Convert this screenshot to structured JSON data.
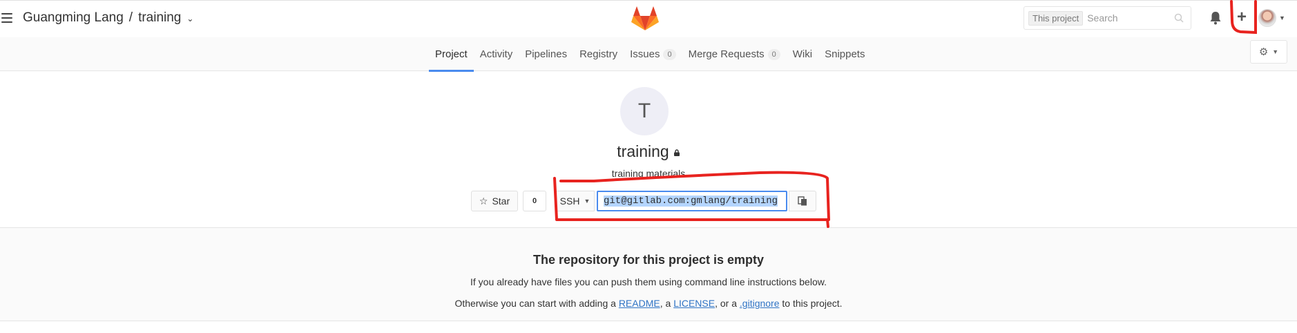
{
  "header": {
    "breadcrumb": {
      "owner": "Guangming Lang",
      "separator": "/",
      "project": "training"
    },
    "search": {
      "scope_label": "This project",
      "placeholder": "Search"
    },
    "icons": [
      "hamburger-icon",
      "gitlab-logo",
      "search-icon",
      "bell-icon",
      "plus-icon",
      "avatar"
    ]
  },
  "nav": {
    "tabs": [
      {
        "label": "Project",
        "active": true
      },
      {
        "label": "Activity"
      },
      {
        "label": "Pipelines"
      },
      {
        "label": "Registry"
      },
      {
        "label": "Issues",
        "badge": "0"
      },
      {
        "label": "Merge Requests",
        "badge": "0"
      },
      {
        "label": "Wiki"
      },
      {
        "label": "Snippets"
      }
    ],
    "accent_color": "#4a8bee"
  },
  "project": {
    "avatar_letter": "T",
    "name": "training",
    "visibility_icon": "lock-icon",
    "description": "training materials",
    "star_label": "Star",
    "star_count": "0",
    "protocol": "SSH",
    "clone_url": "git@gitlab.com:gmlang/training"
  },
  "empty_repo": {
    "title": "The repository for this project is empty",
    "line1": "If you already have files you can push them using command line instructions below.",
    "line2_prefix": "Otherwise you can start with adding a",
    "readme": "README",
    "comma_a": ", a",
    "license": "LICENSE",
    "or_a": ", or a",
    "gitignore": ".gitignore",
    "suffix": "to this project."
  },
  "annotation_color": "#e8231f"
}
